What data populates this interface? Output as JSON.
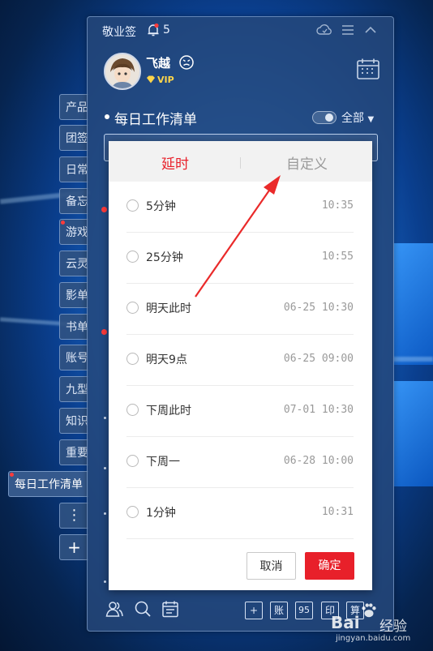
{
  "app": {
    "title": "敬业签",
    "notification_count": "5"
  },
  "profile": {
    "username": "飞越",
    "badge": "VIP"
  },
  "list": {
    "title": "每日工作清单",
    "filter_label": "全部"
  },
  "sidebar": {
    "tabs": [
      {
        "label": "产品"
      },
      {
        "label": "团签"
      },
      {
        "label": "日常"
      },
      {
        "label": "备忘"
      },
      {
        "label": "游戏"
      },
      {
        "label": "云灵"
      },
      {
        "label": "影单"
      },
      {
        "label": "书单"
      },
      {
        "label": "账号"
      },
      {
        "label": "九型"
      },
      {
        "label": "知识"
      },
      {
        "label": "重要"
      }
    ],
    "active_tab": "每日工作清单",
    "more_label": "⋮",
    "add_label": "+"
  },
  "toolbar": {
    "buttons": [
      "+",
      "账",
      "95",
      "印",
      "算"
    ]
  },
  "dialog": {
    "tab_delay": "延时",
    "tab_custom": "自定义",
    "options": [
      {
        "label": "5分钟",
        "time": "10:35"
      },
      {
        "label": "25分钟",
        "time": "10:55"
      },
      {
        "label": "明天此时",
        "time": "06-25 10:30"
      },
      {
        "label": "明天9点",
        "time": "06-25 09:00"
      },
      {
        "label": "下周此时",
        "time": "07-01 10:30"
      },
      {
        "label": "下周一",
        "time": "06-28 10:00"
      },
      {
        "label": "1分钟",
        "time": "10:31"
      }
    ],
    "cancel_label": "取消",
    "confirm_label": "确定"
  },
  "watermark": {
    "brand": "Bai",
    "brand_suffix": "经验",
    "url": "jingyan.baidu.com"
  },
  "colors": {
    "accent_red": "#e8202a",
    "panel_bg": "#26487a"
  }
}
